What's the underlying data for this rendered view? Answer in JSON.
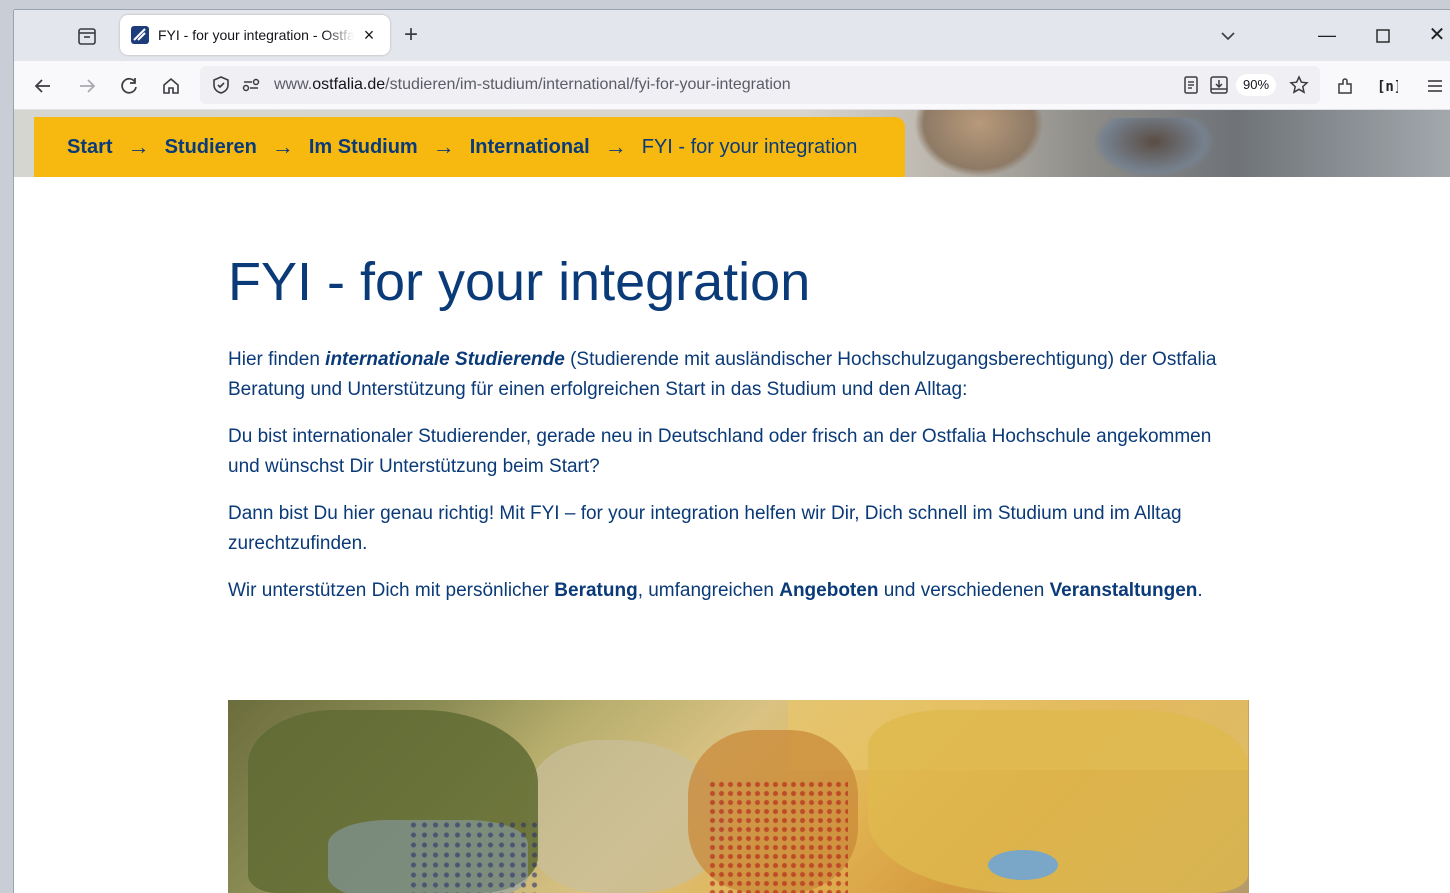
{
  "browser": {
    "tab": {
      "title": "FYI - for your integration - Ostfalia",
      "close_label": "×"
    },
    "new_tab_label": "+",
    "window_controls": {
      "minimize": "—",
      "close": "✕"
    },
    "url": {
      "prefix": "www.",
      "host": "ostfalia.de",
      "path": "/studieren/im-studium/international/fyi-for-your-integration"
    },
    "zoom_level": "90%"
  },
  "breadcrumb": {
    "items": [
      "Start",
      "Studieren",
      "Im Studium",
      "International"
    ],
    "current": "FYI - for your integration",
    "separator": "→"
  },
  "content": {
    "title": "FYI - for your integration",
    "p1": {
      "before": "Hier finden ",
      "emphasis": "internationale Studierende",
      "after": " (Studierende mit ausländischer Hochschulzugangsberechtigung) der Ostfalia Beratung und Unterstützung für einen erfolgreichen Start in das Studium und den Alltag:"
    },
    "p2": "Du bist internationaler Studierender, gerade neu in Deutschland oder frisch an der Ostfalia Hochschule angekommen und wünschst Dir Unterstützung beim Start?",
    "p3": "Dann bist Du hier genau richtig! Mit FYI – for your integration helfen wir Dir, Dich schnell im Studium und im Alltag zurechtzufinden.",
    "p4": {
      "t1": "Wir unterstützen Dich mit persönlicher ",
      "b1": "Beratung",
      "t2": ", umfangreichen ",
      "b2": "Angeboten",
      "t3": " und verschiedenen ",
      "b3": "Veranstaltungen",
      "t4": "."
    }
  },
  "colors": {
    "breadcrumb_bg": "#f7b90f",
    "brand_blue": "#0a3a78"
  }
}
